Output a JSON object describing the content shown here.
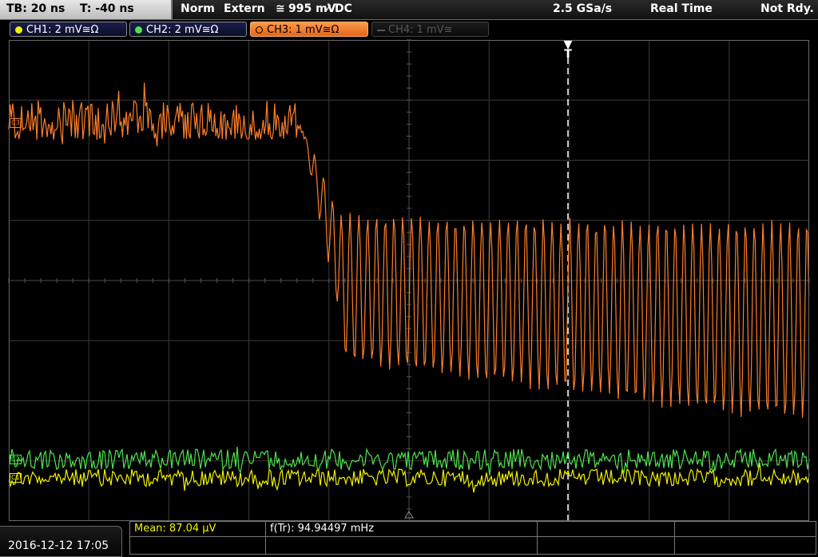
{
  "status_bar": {
    "timebase": "TB: 20 ns",
    "trigger_offset": "T: -40 ns",
    "acq_mode": "Norm",
    "trigger_source": "Extern",
    "trigger_coupling_icon": "≅",
    "trigger_level": "995 mV",
    "trigger_slope_icon": "✓",
    "trigger_coupling": "DC",
    "sample_rate": "2.5 GSa/s",
    "mode": "Real Time",
    "state": "Not Rdy."
  },
  "channels": [
    {
      "label": "CH1: 2 mV≅Ω",
      "color": "#f2f200",
      "state": "on"
    },
    {
      "label": "CH2: 2 mV≅Ω",
      "color": "#4ee34e",
      "state": "on"
    },
    {
      "label": "CH3: 1 mV≅Ω",
      "color": "#ff7f2a",
      "state": "active"
    },
    {
      "label": "CH4: 1 mV≅",
      "color": "#666666",
      "state": "off"
    }
  ],
  "trigger_marker": "T",
  "measurements": {
    "mean": "Mean: 87.04 µV",
    "frequency": "f(Tr): 94.94497 mHz"
  },
  "datetime": "2016-12-12 17:05",
  "marker_labels": {
    "c1": "C1",
    "c2": "C2",
    "c3": "C3"
  },
  "chart_data": {
    "type": "line",
    "x_divisions": 10,
    "y_divisions": 8,
    "series": [
      {
        "name": "CH3",
        "color": "#ff7f2a",
        "desc": "orange: noisy flat ~ +2.6 div then falls and oscillates with growing amplitude"
      },
      {
        "name": "CH2",
        "color": "#4ee34e",
        "desc": "green noise near -2.7 div"
      },
      {
        "name": "CH1",
        "color": "#f2f200",
        "desc": "yellow noise near -3.2 div"
      }
    ]
  }
}
